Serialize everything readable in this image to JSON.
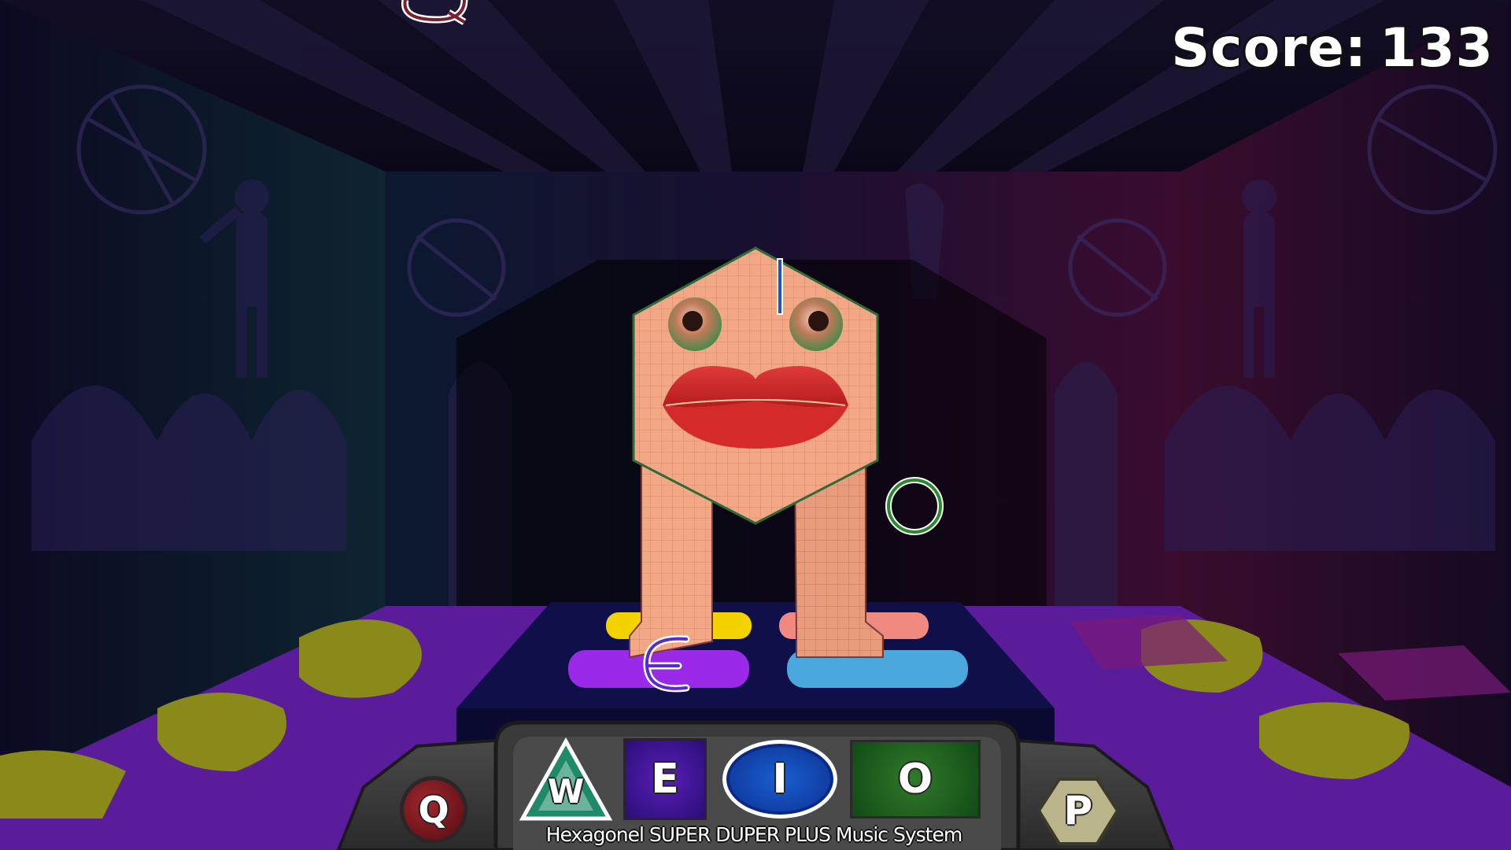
{
  "hud": {
    "score_label": "Score:",
    "score_value": "133"
  },
  "console": {
    "label": "Hexagonel SUPER DUPER PLUS Music System",
    "keys": [
      {
        "id": "q",
        "glyph": "Q",
        "color": "#a0262c"
      },
      {
        "id": "w",
        "glyph": "W",
        "color": "#1e8a6a"
      },
      {
        "id": "e",
        "glyph": "E",
        "color": "#4a18a8"
      },
      {
        "id": "i",
        "glyph": "I",
        "color": "#1a4fbf"
      },
      {
        "id": "o",
        "glyph": "O",
        "color": "#2a6a26"
      },
      {
        "id": "p",
        "glyph": "P",
        "color": "#b9b48a"
      }
    ]
  },
  "falling_notes": [
    {
      "glyph": "Q",
      "color": "#ffffff"
    },
    {
      "glyph": "I",
      "color": "#2a4fbf"
    },
    {
      "glyph": "O",
      "color": "#2b8a2b"
    },
    {
      "glyph": "E",
      "color": "#5a2ad0"
    }
  ],
  "dance_pads": [
    {
      "name": "yellow",
      "color": "#f4d200"
    },
    {
      "name": "pink",
      "color": "#f08a80"
    },
    {
      "name": "purple",
      "color": "#9a2ae8"
    },
    {
      "name": "blue",
      "color": "#4aa8dc"
    }
  ],
  "colors": {
    "floor_purple": "#5a1c9a",
    "floor_olive": "#8a8a1a",
    "character_skin": "#f3a884",
    "lips": "#d42a2a"
  }
}
